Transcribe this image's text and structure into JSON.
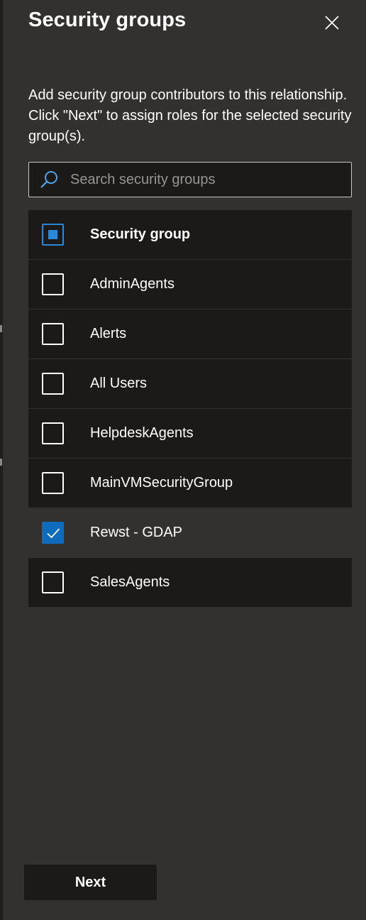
{
  "panel": {
    "title": "Security groups",
    "description": "Add security group contributors to this relationship. Click \"Next\" to assign roles for the selected security group(s).",
    "close_icon": "close-icon"
  },
  "search": {
    "placeholder": "Search security groups",
    "value": "",
    "icon": "search-icon"
  },
  "table": {
    "header": {
      "label": "Security group",
      "select_all_state": "indeterminate"
    },
    "rows": [
      {
        "label": "AdminAgents",
        "checked": false
      },
      {
        "label": "Alerts",
        "checked": false
      },
      {
        "label": "All Users",
        "checked": false
      },
      {
        "label": "HelpdeskAgents",
        "checked": false
      },
      {
        "label": "MainVMSecurityGroup",
        "checked": false
      },
      {
        "label": "Rewst - GDAP",
        "checked": true
      },
      {
        "label": "SalesAgents",
        "checked": false
      }
    ]
  },
  "footer": {
    "next_label": "Next"
  },
  "colors": {
    "accent": "#0f6cbd",
    "panel_bg": "#323130",
    "row_bg": "#1b1a19"
  }
}
